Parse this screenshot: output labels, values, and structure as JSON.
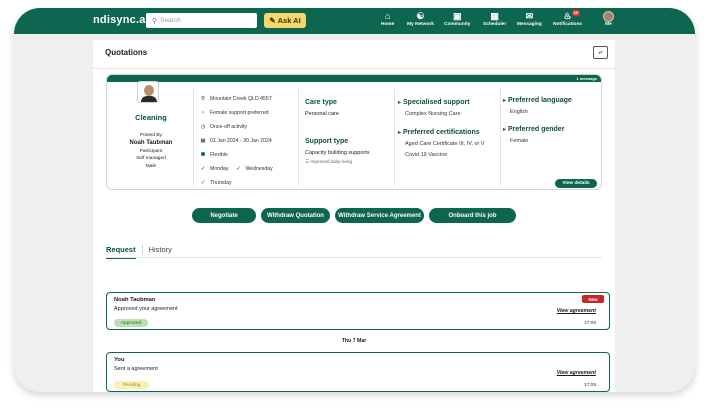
{
  "header": {
    "logo": "ndisync.ai",
    "search_placeholder": "Search",
    "ask_ai_label": "Ask AI",
    "nav": [
      {
        "label": "Home",
        "icon": "home-icon"
      },
      {
        "label": "My Network",
        "icon": "network-icon"
      },
      {
        "label": "Community",
        "icon": "community-icon"
      },
      {
        "label": "Scheduler",
        "icon": "calendar-icon"
      },
      {
        "label": "Messaging",
        "icon": "message-icon"
      },
      {
        "label": "Notifications",
        "icon": "bell-icon",
        "badge": "20"
      }
    ],
    "me_label": "Me"
  },
  "page": {
    "title": "Quotations"
  },
  "job": {
    "message_count": "1 message",
    "title": "Cleaning",
    "posted_by_label": "Posted By",
    "poster_name": "Noah Taubman",
    "poster_role": "Participant",
    "poster_management": "Self managed",
    "poster_gender": "Male",
    "details": {
      "location": "Mountain Creek QLD 4557",
      "support_pref": "Female support preferred",
      "activity": "Once-off activity",
      "dates": "01 Jan 2024 - 30 Jan 2024",
      "flexibility": "Flexible",
      "day1": "Monday",
      "day2": "Wednesday",
      "day3": "Thursday"
    },
    "care_type_label": "Care type",
    "care_type_value": "Personal care",
    "support_type_label": "Support type",
    "support_type_value": "Capacity building supports",
    "support_type_sub": "Improved daily living",
    "specialised_label": "Specialised support",
    "specialised_value": "Complex Nursing Care",
    "certs_label": "Preferred certifications",
    "certs_value1": "Aged Care Certificate III, IV, or V",
    "certs_value2": "Covid 19 Vaccine",
    "language_label": "Preferred language",
    "language_value": "English",
    "gender_label": "Preferred gender",
    "gender_value": "Female",
    "view_details": "View details"
  },
  "actions": {
    "negotiate": "Negotiate",
    "withdraw_quotation": "Withdraw Quotation",
    "withdraw_agreement": "Withdraw Service Agreement",
    "onboard": "Onboard this job"
  },
  "tabs": {
    "request": "Request",
    "history": "History"
  },
  "timeline": {
    "item1": {
      "who": "Noah Taubman",
      "msg": "Approved your agreement",
      "status": "Approved",
      "badge": "New",
      "link": "View agreement",
      "time": "17:09"
    },
    "date_sep": "Thu 7 Mar",
    "item2": {
      "who": "You",
      "msg": "Sent a agreement",
      "status": "Pending",
      "link": "View agreement",
      "time": "17:09"
    }
  },
  "colors": {
    "brand": "#0c6650",
    "accent": "#f6d86a",
    "new_badge": "#c62828"
  }
}
